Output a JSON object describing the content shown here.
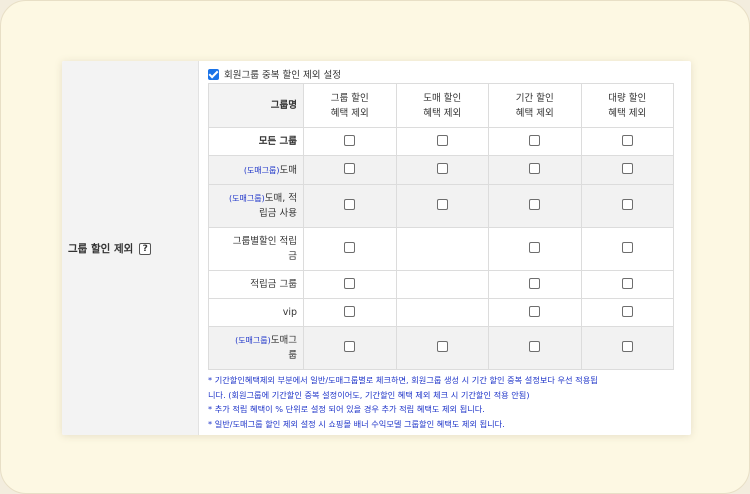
{
  "label": {
    "title": "그룹 할인 제외",
    "help": "?"
  },
  "top_option": {
    "label": "회원그룹 중복 할인 제외 설정",
    "checked": true
  },
  "table": {
    "name_header": "그룹명",
    "columns": [
      {
        "line1": "그룹 할인",
        "line2": "혜택 제외"
      },
      {
        "line1": "도매 할인",
        "line2": "혜택 제외"
      },
      {
        "line1": "기간 할인",
        "line2": "혜택 제외"
      },
      {
        "line1": "대량 할인",
        "line2": "혜택 제외"
      }
    ],
    "rows": [
      {
        "tag": "",
        "name": "모든 그룹",
        "line2": "",
        "bold": true,
        "cells": [
          true,
          true,
          true,
          true
        ]
      },
      {
        "tag": "(도매그룹)",
        "name": "도매",
        "line2": "",
        "cells": [
          true,
          true,
          true,
          true
        ]
      },
      {
        "tag": "(도매그룹)",
        "name": "도매, 적",
        "line2": "립금 사용",
        "cells": [
          true,
          true,
          true,
          true
        ]
      },
      {
        "tag": "",
        "name": "그룹별할인 적립",
        "line2": "금",
        "cells": [
          true,
          false,
          true,
          true
        ]
      },
      {
        "tag": "",
        "name": "적립금 그룹",
        "line2": "",
        "cells": [
          true,
          false,
          true,
          true
        ]
      },
      {
        "tag": "",
        "name": "vip",
        "line2": "",
        "cells": [
          true,
          false,
          true,
          true
        ]
      },
      {
        "tag": "(도매그룹)",
        "name": "도매그",
        "line2": "룹",
        "cells": [
          true,
          true,
          true,
          true
        ]
      }
    ]
  },
  "notes": [
    "* 기간할인혜택제외 부분에서 일반/도매그룹별로 체크하면, 회원그룹 생성 시 기간 할인 중복 설정보다 우선 적용됩",
    "니다. (회원그룹에 기간할인 중복 설정이어도, 기간할인 혜택 제외 체크 시 기간할인 적용 안됨)",
    "* 추가 적립 혜택이 % 단위로 설정 되어 있을 경우 추가 적립 혜택도 제외 됩니다.",
    "* 일반/도매그룹 할인 제외 설정 시 쇼핑몰 배너 수익모델 그룹할인 혜택도 제외 됩니다."
  ]
}
